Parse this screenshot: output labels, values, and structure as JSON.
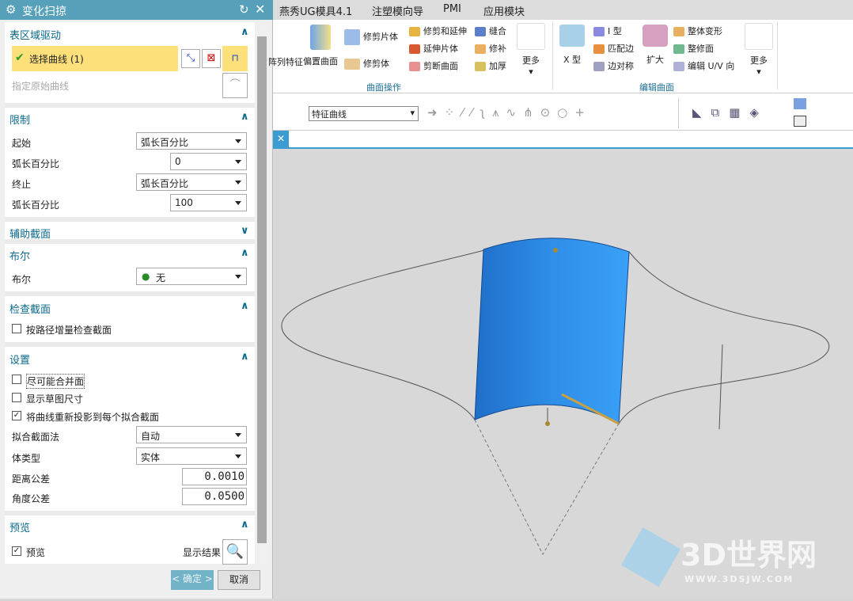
{
  "dialog": {
    "title": "变化扫掠",
    "icons": [
      "gear-icon",
      "reset-icon",
      "close-icon"
    ],
    "sections": {
      "drive": {
        "title": "表区域驱动",
        "select_curve": "选择曲线 (1)",
        "original_curve": "指定原始曲线"
      },
      "limits": {
        "title": "限制",
        "start_label": "起始",
        "start_value": "弧长百分比",
        "start_pct_label": "弧长百分比",
        "start_pct_value": "0",
        "end_label": "终止",
        "end_value": "弧长百分比",
        "end_pct_label": "弧长百分比",
        "end_pct_value": "100"
      },
      "aux": {
        "title": "辅助截面"
      },
      "boolean": {
        "title": "布尔",
        "label": "布尔",
        "value": "无"
      },
      "check": {
        "title": "检查截面",
        "option": "按路径增量检查截面",
        "checked": false
      },
      "settings": {
        "title": "设置",
        "options": [
          {
            "label": "尽可能合并面",
            "checked": false
          },
          {
            "label": "显示草图尺寸",
            "checked": false
          },
          {
            "label": "将曲线重新投影到每个拟合截面",
            "checked": true
          }
        ],
        "fit_label": "拟合截面法",
        "fit_value": "自动",
        "body_label": "体类型",
        "body_value": "实体",
        "dist_label": "距离公差",
        "dist_value": "0.0010",
        "angle_label": "角度公差",
        "angle_value": "0.0500"
      },
      "preview": {
        "title": "预览",
        "option": "预览",
        "checked": true,
        "show_result": "显示结果"
      }
    },
    "ok": "< 确定 >",
    "cancel": "取消"
  },
  "menubar": [
    "燕秀UG模具4.1",
    "注塑模向导",
    "PMI",
    "应用模块"
  ],
  "ribbon": {
    "group1": {
      "label": "曲面操作",
      "items": [
        "阵列特征",
        "偏置曲面",
        "修剪片体",
        "修剪体",
        "修剪和延伸",
        "延伸片体",
        "剪断曲面",
        "缝合",
        "修补",
        "加厚",
        "更多"
      ]
    },
    "group2": {
      "label": "编辑曲面",
      "items": [
        "X 型",
        "I 型",
        "匹配边",
        "边对称",
        "扩大",
        "整体变形",
        "整修面",
        "编辑 U/V 向",
        "更多"
      ]
    }
  },
  "toolbar": {
    "curve_filter": "特征曲线"
  },
  "watermark": {
    "text": "3D世界网",
    "url": "WWW.3DSJW.COM"
  },
  "colors": {
    "header": "#56a0b9",
    "selected": "#fde07a",
    "surface": "#2e8ee8"
  }
}
